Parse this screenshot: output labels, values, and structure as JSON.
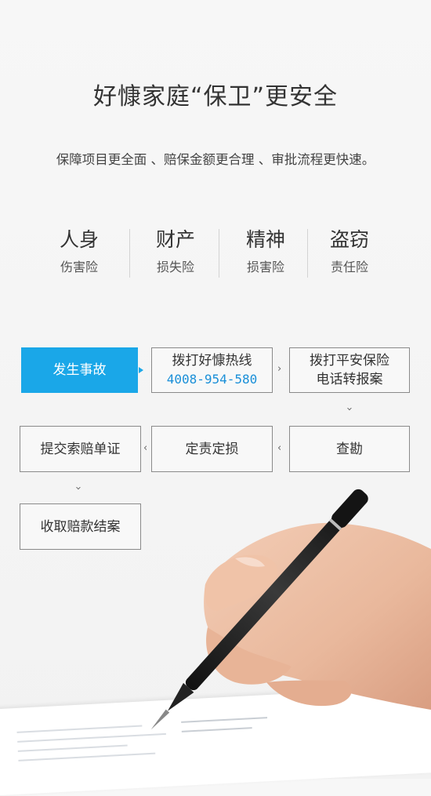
{
  "header": {
    "title": "好慷家庭“保卫”更安全",
    "subtitle": "保障项目更全面 、赔保金额更合理 、审批流程更快速。"
  },
  "insurance": [
    {
      "name": "人身",
      "type": "伤害险"
    },
    {
      "name": "财产",
      "type": "损失险"
    },
    {
      "name": "精神",
      "type": "损害险"
    },
    {
      "name": "盗窃",
      "type": "责任险"
    }
  ],
  "process": {
    "step1": "发生事故",
    "step2_line1": "拨打好慷热线",
    "step2_phone": "4008-954-580",
    "step3_line1": "拨打平安保险",
    "step3_line2": "电话转报案",
    "step4": "查勘",
    "step5": "定责定损",
    "step6": "提交索赔单证",
    "step7": "收取赔款结案"
  },
  "colors": {
    "accent": "#1aa7e8",
    "phone": "#1a8fd8",
    "text": "#333333",
    "border": "#8a8a8a"
  },
  "icons": {
    "arrow_right": "chevron-right-icon",
    "arrow_left": "chevron-left-icon",
    "arrow_down": "chevron-down-icon",
    "illustration": "hand-writing-pen-illustration"
  }
}
